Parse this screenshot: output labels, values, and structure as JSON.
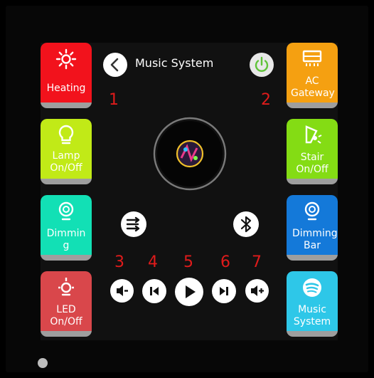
{
  "header": {
    "title": "Music System"
  },
  "tiles_left": [
    {
      "label": "Heating",
      "icon": "sun-icon",
      "color": "#f2121c"
    },
    {
      "label": "Lamp On/Off",
      "icon": "bulb-icon",
      "color": "#c1ea17"
    },
    {
      "label": "Dimming",
      "icon": "dimmer-bulb-icon",
      "color": "#12e0b5"
    },
    {
      "label": "LED On/Off",
      "icon": "led-bulb-icon",
      "color": "#d9474b"
    }
  ],
  "tiles_right": [
    {
      "label": "AC Gateway",
      "icon": "ac-unit-icon",
      "color": "#f5a011"
    },
    {
      "label": "Stair On/Off",
      "icon": "stair-light-icon",
      "color": "#84dc14"
    },
    {
      "label": "Dimming Bar",
      "icon": "dimmer-bulb-icon",
      "color": "#1479d9"
    },
    {
      "label": "Music System",
      "icon": "spotify-icon",
      "color": "#2ec7e8"
    }
  ],
  "annotations": [
    "1",
    "2",
    "3",
    "4",
    "5",
    "6",
    "7"
  ],
  "controls": {
    "shuffle": "shuffle-icon",
    "bluetooth": "bluetooth-icon",
    "volume_down": "volume-down-icon",
    "previous": "previous-icon",
    "play": "play-icon",
    "next": "next-icon",
    "volume_up": "volume-up-icon"
  }
}
